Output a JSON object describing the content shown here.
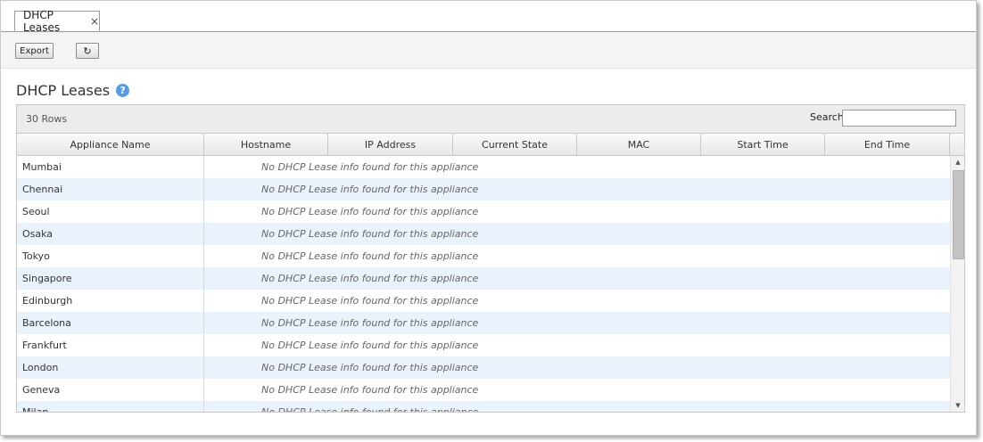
{
  "tab": {
    "label": "DHCP Leases",
    "close": "×"
  },
  "toolbar": {
    "export_label": "Export",
    "refresh_label": "↻"
  },
  "page": {
    "title": "DHCP Leases",
    "help": "?"
  },
  "grid": {
    "row_count": "30 Rows",
    "search_label": "Search",
    "search_value": "",
    "columns": [
      "Appliance Name",
      "Hostname",
      "IP Address",
      "Current State",
      "MAC",
      "Start Time",
      "End Time"
    ],
    "empty_message": "No DHCP Lease info found for this appliance",
    "rows": [
      {
        "name": "Mumbai",
        "message": "No DHCP Lease info found for this appliance"
      },
      {
        "name": "Chennai",
        "message": "No DHCP Lease info found for this appliance"
      },
      {
        "name": "Seoul",
        "message": "No DHCP Lease info found for this appliance"
      },
      {
        "name": "Osaka",
        "message": "No DHCP Lease info found for this appliance"
      },
      {
        "name": "Tokyo",
        "message": "No DHCP Lease info found for this appliance"
      },
      {
        "name": "Singapore",
        "message": "No DHCP Lease info found for this appliance"
      },
      {
        "name": "Edinburgh",
        "message": "No DHCP Lease info found for this appliance"
      },
      {
        "name": "Barcelona",
        "message": "No DHCP Lease info found for this appliance"
      },
      {
        "name": "Frankfurt",
        "message": "No DHCP Lease info found for this appliance"
      },
      {
        "name": "London",
        "message": "No DHCP Lease info found for this appliance"
      },
      {
        "name": "Geneva",
        "message": "No DHCP Lease info found for this appliance"
      },
      {
        "name": "Milan",
        "message": "No DHCP Lease info found for this appliance"
      }
    ]
  },
  "colors": {
    "alt_row": "#eaf3fc",
    "help_icon": "#5b9bdf"
  }
}
